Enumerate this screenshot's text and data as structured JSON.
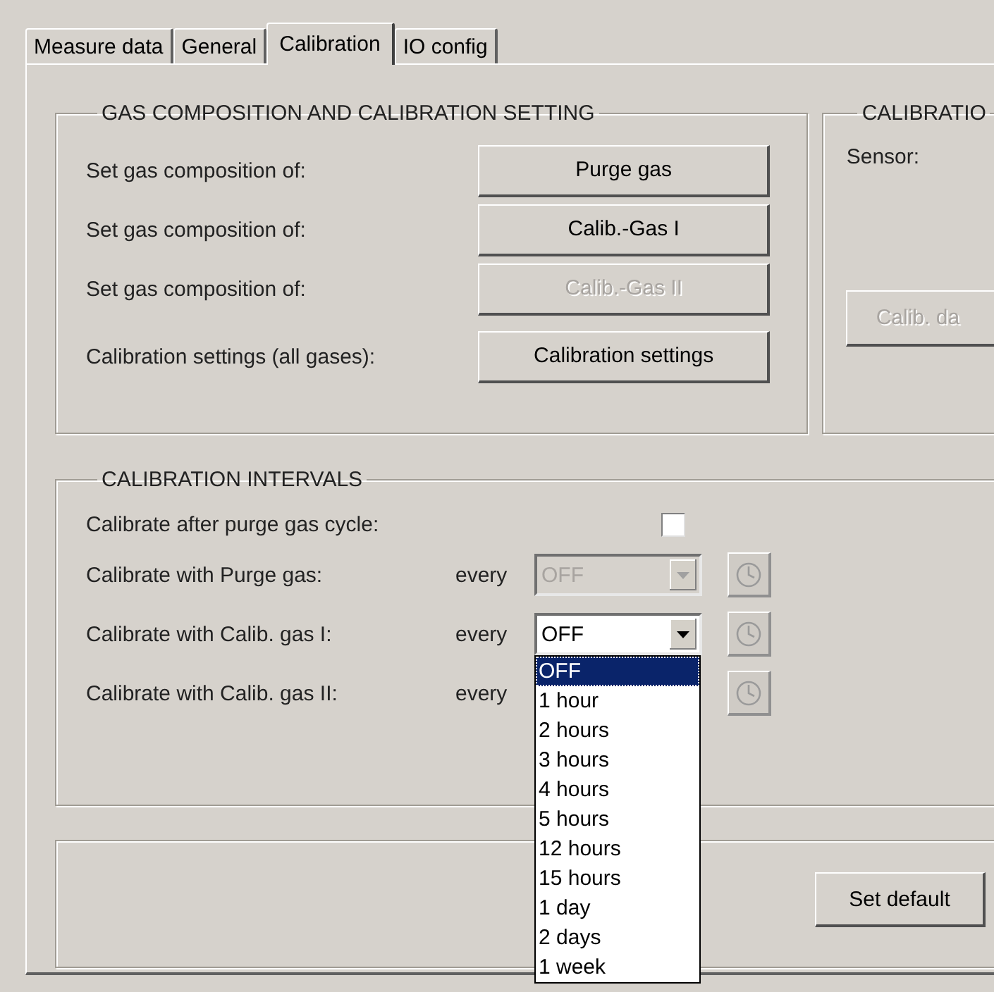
{
  "tabs": [
    {
      "label": "Measure data",
      "selected": false
    },
    {
      "label": "General",
      "selected": false
    },
    {
      "label": "Calibration",
      "selected": true
    },
    {
      "label": "IO config",
      "selected": false
    }
  ],
  "gas_composition": {
    "title": "GAS COMPOSITION AND CALIBRATION SETTING",
    "rows": [
      {
        "label": "Set gas composition of:",
        "button": "Purge gas",
        "disabled": false
      },
      {
        "label": "Set gas composition of:",
        "button": "Calib.-Gas I",
        "disabled": false
      },
      {
        "label": "Set gas composition of:",
        "button": "Calib.-Gas II",
        "disabled": true
      },
      {
        "label": "Calibration settings (all gases):",
        "button": "Calibration settings",
        "disabled": false
      }
    ]
  },
  "calibration_panel": {
    "title": "CALIBRATIO",
    "sensor_label": "Sensor:",
    "button": {
      "label": "Calib. da",
      "disabled": true
    }
  },
  "intervals": {
    "title": "CALIBRATION INTERVALS",
    "after_purge": {
      "label": "Calibrate after purge gas cycle:",
      "checked": false
    },
    "rows": [
      {
        "label": "Calibrate with Purge gas:",
        "every": "every",
        "value": "OFF",
        "disabled": true
      },
      {
        "label": "Calibrate with Calib. gas I:",
        "every": "every",
        "value": "OFF",
        "disabled": false,
        "options": [
          {
            "label": "OFF",
            "selected": true
          },
          {
            "label": "1 hour",
            "selected": false
          },
          {
            "label": "2 hours",
            "selected": false
          },
          {
            "label": "3 hours",
            "selected": false
          },
          {
            "label": "4 hours",
            "selected": false
          },
          {
            "label": "5 hours",
            "selected": false
          },
          {
            "label": "12 hours",
            "selected": false
          },
          {
            "label": "15 hours",
            "selected": false
          },
          {
            "label": "1 day",
            "selected": false
          },
          {
            "label": "2 days",
            "selected": false
          },
          {
            "label": "1 week",
            "selected": false
          }
        ]
      },
      {
        "label": "Calibrate with Calib. gas II:",
        "every": "every"
      }
    ]
  },
  "bottom": {
    "button": "Set default"
  }
}
